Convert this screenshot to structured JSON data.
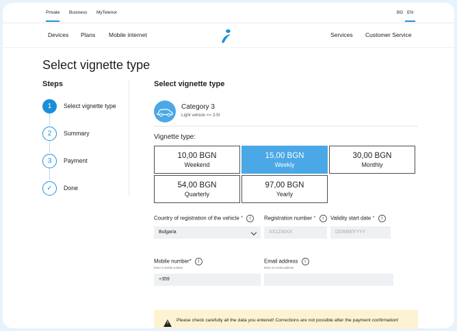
{
  "topbar": {
    "segments": [
      "Private",
      "Business",
      "MyTelenor"
    ],
    "languages": [
      "BG",
      "EN"
    ]
  },
  "nav": {
    "left": [
      "Devices",
      "Plans",
      "Mobile internet"
    ],
    "right": [
      "Services",
      "Customer Service"
    ],
    "logo": "telenor-logo"
  },
  "page": {
    "title": "Select vignette type"
  },
  "steps": {
    "title": "Steps",
    "items": [
      {
        "marker": "1",
        "label": "Select vignette type"
      },
      {
        "marker": "2",
        "label": "Summary"
      },
      {
        "marker": "3",
        "label": "Payment"
      },
      {
        "marker": "✓",
        "label": "Done"
      }
    ]
  },
  "main": {
    "title": "Select vignette type",
    "category": {
      "name": "Category 3",
      "description": "Light vehicle <= 3.5t",
      "icon": "car-icon"
    },
    "vignette_title": "Vignette type:",
    "options": [
      {
        "price": "10,00 BGN",
        "period": "Weekend"
      },
      {
        "price": "15,00 BGN",
        "period": "Weekly"
      },
      {
        "price": "30,00 BGN",
        "period": "Monthly"
      },
      {
        "price": "54,00 BGN",
        "period": "Quarterly"
      },
      {
        "price": "97,00 BGN",
        "period": "Yearly"
      }
    ],
    "selected_option": "Weekly"
  },
  "form": {
    "country_label": "Country of registration of the vehicle",
    "country_value": "Bulgaria",
    "reg_label": "Registration number",
    "reg_placeholder": "XX1234XX",
    "validity_label": "Validity start date",
    "validity_placeholder": "DD/MM/YYYY",
    "mobile_label": "Mobile number*",
    "mobile_hint": "Enter a mobile number",
    "mobile_value": "+359",
    "email_label": "Email address",
    "email_hint": "Enter an email address",
    "email_value": "",
    "required_mark": "*",
    "info_glyph": "i"
  },
  "warning": {
    "text": "Please check carefully all the data you entered! Corrections are not possible after the payment confirmation!",
    "icon": "warning-icon"
  },
  "colors": {
    "accent": "#1a8fd8",
    "selected": "#4aa8e6",
    "warning_bg": "#fdf3d3",
    "required": "#e53935"
  }
}
